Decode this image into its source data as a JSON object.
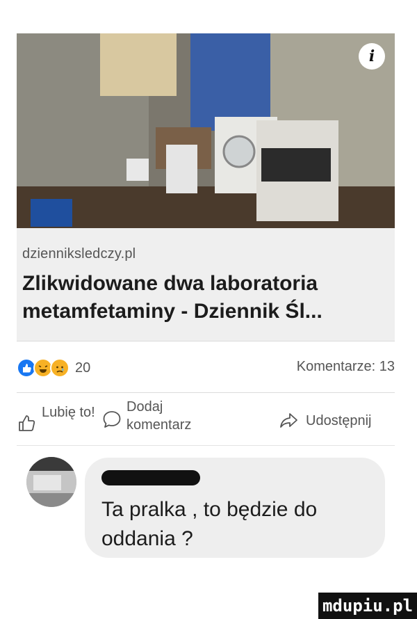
{
  "post": {
    "domain": "dzienniksledczy.pl",
    "title": "Zlikwidowane dwa laboratoria metamfetaminy - Dziennik Śl..."
  },
  "reactions": {
    "count": "20",
    "comments": "Komentarze: 13"
  },
  "actions": {
    "like": "Lubię to!",
    "comment": "Dodaj komentarz",
    "share": "Udostępnij"
  },
  "comment": {
    "text": "Ta pralka , to będzie do oddania ?"
  },
  "watermark": "mdupiu.pl",
  "icons": {
    "info": "info-icon",
    "like": "thumb-up-icon",
    "comment": "comment-bubble-icon",
    "share": "share-arrow-icon"
  },
  "colors": {
    "like_reaction": "#1877f2",
    "emoji_reaction": "#f7b125"
  }
}
